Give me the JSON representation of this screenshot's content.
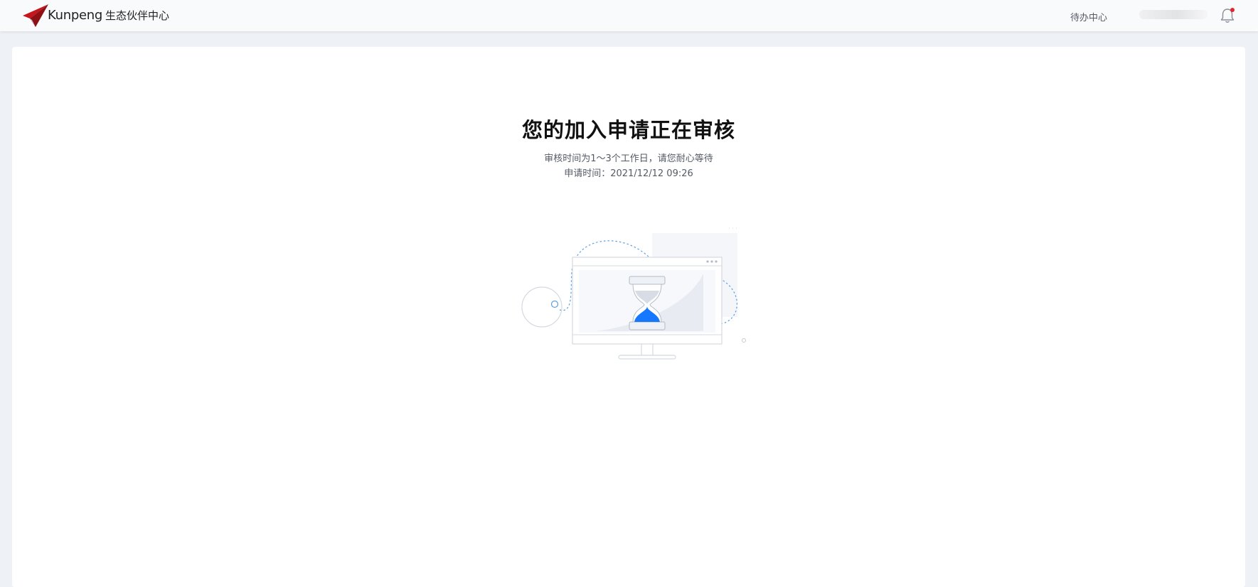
{
  "header": {
    "brand": "Kunpeng",
    "product": "生态伙伴中心",
    "todo_label": "待办中心",
    "logo_icon": "kunpeng-logo-icon",
    "bell_icon": "bell-icon",
    "accent": "#c4161c"
  },
  "main": {
    "title": "您的加入申请正在审核",
    "review_note": "审核时间为1～3个工作日，请您耐心等待",
    "apply_time_label": "申请时间：",
    "apply_time_value": "2021/12/12 09:26",
    "illustration_icon": "hourglass-monitor-icon",
    "sand_color": "#1677ff"
  }
}
